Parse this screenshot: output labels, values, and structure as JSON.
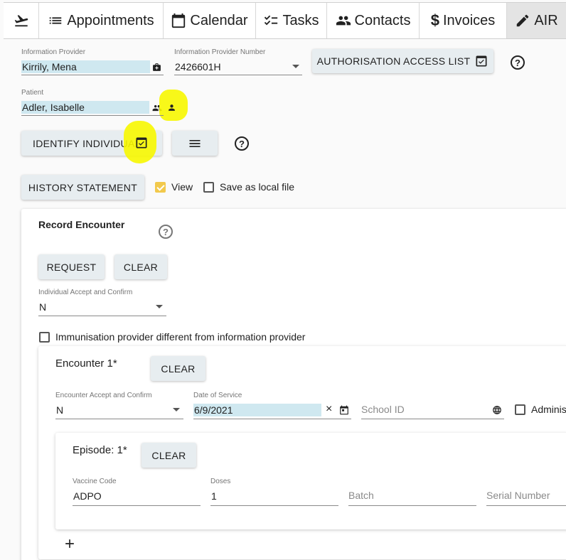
{
  "nav": {
    "tabs": [
      {
        "label": ""
      },
      {
        "label": "Appointments"
      },
      {
        "label": "Calendar"
      },
      {
        "label": "Tasks"
      },
      {
        "label": "Contacts"
      },
      {
        "label": "Invoices"
      },
      {
        "label": "AIR"
      }
    ]
  },
  "provider": {
    "info_label": "Information Provider",
    "info_value": "Kirrily, Mena",
    "number_label": "Information Provider Number",
    "number_value": "2426601H",
    "auth_button": "AUTHORISATION ACCESS LIST"
  },
  "patient": {
    "label": "Patient",
    "value": "Adler, Isabelle"
  },
  "actions": {
    "identify_button": "IDENTIFY INDIVIDUAL",
    "history_button": "HISTORY STATEMENT",
    "view_label": "View",
    "save_local_label": "Save as local file"
  },
  "record": {
    "title": "Record Encounter",
    "request_button": "REQUEST",
    "clear_button": "CLEAR",
    "accept_label": "Individual Accept and Confirm",
    "accept_value": "N",
    "diff_provider_label": "Immunisation provider different from information provider"
  },
  "encounter": {
    "title": "Encounter 1*",
    "clear_button": "CLEAR",
    "accept_label": "Encounter Accept and Confirm",
    "accept_value": "N",
    "date_label": "Date of Service",
    "date_value": "6/9/2021",
    "school_placeholder": "School ID",
    "admin_label": "Adminis"
  },
  "episode": {
    "title": "Episode: 1*",
    "clear_button": "CLEAR",
    "vaccine_label": "Vaccine Code",
    "vaccine_value": "ADPO",
    "doses_label": "Doses",
    "doses_value": "1",
    "batch_placeholder": "Batch",
    "serial_placeholder": "Serial Number"
  },
  "colors": {
    "highlight": "#cfe8f0",
    "annotation_yellow": "#f7f700",
    "checkbox_on": "#f2c94c"
  }
}
